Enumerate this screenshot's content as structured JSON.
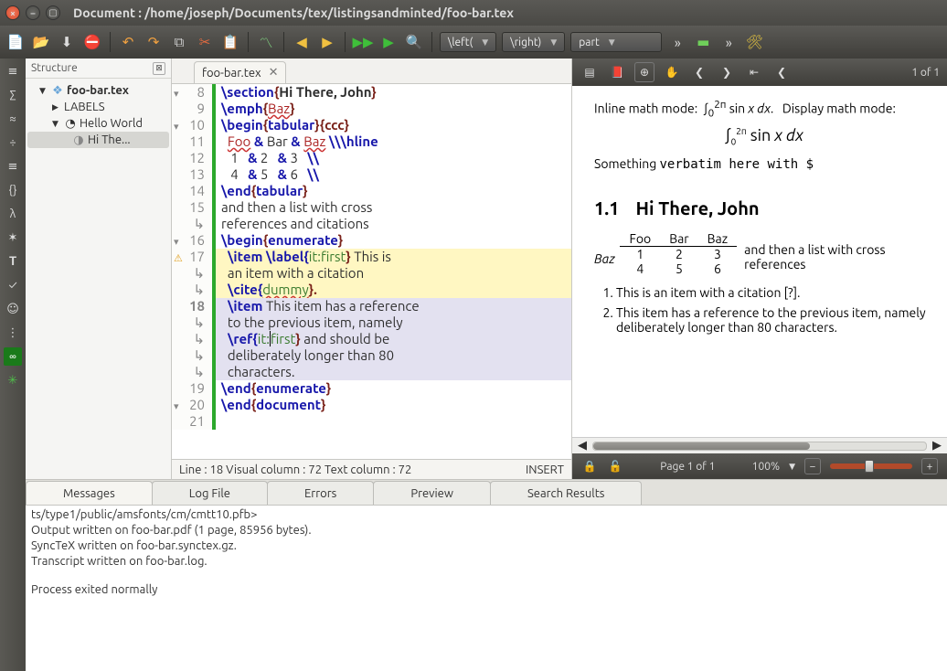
{
  "window": {
    "title": "Document : /home/joseph/Documents/tex/listingsandminted/foo-bar.tex"
  },
  "toolbar": {
    "dd_left": "\\left(",
    "dd_right": "\\right)",
    "dd_part": "part"
  },
  "structure": {
    "title": "Structure",
    "root": "foo-bar.tex",
    "labels": "LABELS",
    "hello": "Hello World",
    "hi": "Hi The..."
  },
  "editor": {
    "tab": "foo-bar.tex",
    "status_left": "Line : 18 Visual column : 72 Text column : 72",
    "status_right": "INSERT",
    "lines": {
      "l8a": "\\section",
      "l8b": "{",
      "l8c": "Hi There, John",
      "l8d": "}",
      "l9a": "\\emph",
      "l9b": "{",
      "l9c": "Baz",
      "l9d": "}",
      "l10a": "\\begin",
      "l10b": "{",
      "l10c": "tabular",
      "l10d": "}{ccc}",
      "l11a": "  ",
      "l11b": "Foo",
      "l11c": " & ",
      "l11d": "Bar",
      "l11e": " & ",
      "l11f": "Baz",
      "l11g": " \\\\\\hline",
      "l12": "   1   & 2   & 3   \\\\",
      "l13": "   4   & 5   & 6   \\\\",
      "l14a": "\\end",
      "l14b": "{",
      "l14c": "tabular",
      "l14d": "}",
      "l15a": "and then a list with cross",
      "l15b": "references and citations",
      "l16a": "\\begin",
      "l16b": "{",
      "l16c": "enumerate",
      "l16d": "}",
      "l17a": "  \\item ",
      "l17b": "\\label{",
      "l17c": "it:first",
      "l17d": "}",
      " l17e": " This is",
      "l17f": "  an item with a citation",
      "l17g": "  \\cite{",
      "l17h": "dummy",
      "l17i": "}.",
      "l18a": "  \\item ",
      "l18b": "This item has a reference",
      "l18c": "  to the previous item, namely",
      "l18d": "  \\ref{",
      "l18e": "it:",
      "l18f": "first",
      "l18g": "} and should be",
      "l18h": "  deliberately longer than 80",
      "l18i": "  characters.",
      "l19a": "\\end",
      "l19b": "{",
      "l19c": "enumerate",
      "l19d": "}",
      "l20a": "\\end",
      "l20b": "{",
      "l20c": "document",
      "l20d": "}"
    }
  },
  "preview": {
    "pages": "1 of 1",
    "inline_label": "Inline math mode:",
    "display_label": "Display math mode:",
    "something": "Something ",
    "verbatim": "verbatim here with $",
    "secnum": "1.1",
    "sectitle": "Hi There, John",
    "th_foo": "Foo",
    "th_bar": "Bar",
    "th_baz": "Baz",
    "row_baz": "Baz",
    "aftertab": "and then a list with cross references",
    "li1": "This is an item with a citation [?].",
    "li2": "This item has a reference to the previous item, namely deliberately longer than 80 characters.",
    "footer_page": "Page 1 of 1",
    "footer_zoom": "100%"
  },
  "bottom_tabs": {
    "messages": "Messages",
    "log": "Log File",
    "errors": "Errors",
    "preview": "Preview",
    "search": "Search Results"
  },
  "log": {
    "l0": "ts/type1/public/amsfonts/cm/cmtt10.pfb>",
    "l1": "Output written on foo-bar.pdf (1 page, 85956 bytes).",
    "l2": "SyncTeX written on foo-bar.synctex.gz.",
    "l3": "Transcript written on foo-bar.log.",
    "l4": "Process exited normally"
  }
}
